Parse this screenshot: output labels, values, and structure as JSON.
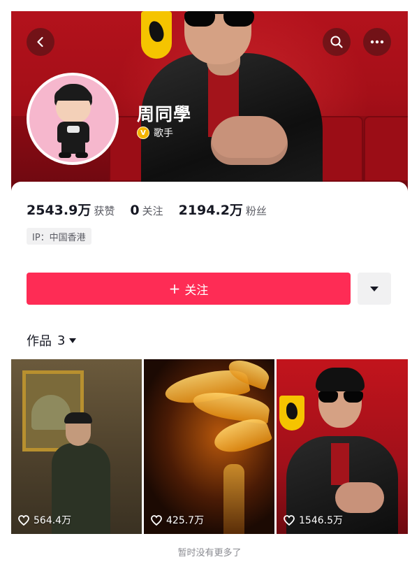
{
  "profile": {
    "name": "周同學",
    "role": "歌手",
    "verified_icon": "v-verified-icon"
  },
  "stats": [
    {
      "value": "2543.9万",
      "label": "获赞"
    },
    {
      "value": "0",
      "label": "关注"
    },
    {
      "value": "2194.2万",
      "label": "粉丝"
    }
  ],
  "ip_location": "IP：中国香港",
  "actions": {
    "follow_label": "关注",
    "follow_plus": "+"
  },
  "works": {
    "tab_label": "作品",
    "count": "3"
  },
  "videos": [
    {
      "likes": "564.4万"
    },
    {
      "likes": "425.7万"
    },
    {
      "likes": "1546.5万"
    }
  ],
  "footer": "暂时没有更多了",
  "colors": {
    "accent": "#fe2c55",
    "banner": "#b3121c",
    "verified": "#f4b400"
  }
}
